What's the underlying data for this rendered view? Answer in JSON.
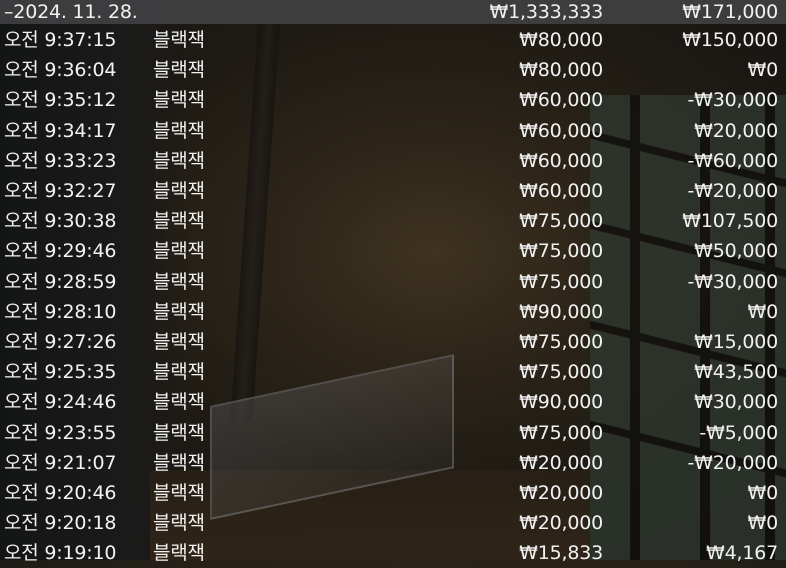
{
  "header": {
    "date": "–2024. 11. 28.",
    "total": "₩1,333,333",
    "total_diff": "₩171,000"
  },
  "rows": [
    {
      "time": "오전 9:37:15",
      "item": "블랙잭",
      "amount": "₩80,000",
      "diff": "₩150,000"
    },
    {
      "time": "오전 9:36:04",
      "item": "블랙잭",
      "amount": "₩80,000",
      "diff": "₩0"
    },
    {
      "time": "오전 9:35:12",
      "item": "블랙잭",
      "amount": "₩60,000",
      "diff": "-₩30,000"
    },
    {
      "time": "오전 9:34:17",
      "item": "블랙잭",
      "amount": "₩60,000",
      "diff": "₩20,000"
    },
    {
      "time": "오전 9:33:23",
      "item": "블랙잭",
      "amount": "₩60,000",
      "diff": "-₩60,000"
    },
    {
      "time": "오전 9:32:27",
      "item": "블랙잭",
      "amount": "₩60,000",
      "diff": "-₩20,000"
    },
    {
      "time": "오전 9:30:38",
      "item": "블랙잭",
      "amount": "₩75,000",
      "diff": "₩107,500"
    },
    {
      "time": "오전 9:29:46",
      "item": "블랙잭",
      "amount": "₩75,000",
      "diff": "₩50,000"
    },
    {
      "time": "오전 9:28:59",
      "item": "블랙잭",
      "amount": "₩75,000",
      "diff": "-₩30,000"
    },
    {
      "time": "오전 9:28:10",
      "item": "블랙잭",
      "amount": "₩90,000",
      "diff": "₩0"
    },
    {
      "time": "오전 9:27:26",
      "item": "블랙잭",
      "amount": "₩75,000",
      "diff": "₩15,000"
    },
    {
      "time": "오전 9:25:35",
      "item": "블랙잭",
      "amount": "₩75,000",
      "diff": "₩43,500"
    },
    {
      "time": "오전 9:24:46",
      "item": "블랙잭",
      "amount": "₩90,000",
      "diff": "₩30,000"
    },
    {
      "time": "오전 9:23:55",
      "item": "블랙잭",
      "amount": "₩75,000",
      "diff": "-₩5,000"
    },
    {
      "time": "오전 9:21:07",
      "item": "블랙잭",
      "amount": "₩20,000",
      "diff": "-₩20,000"
    },
    {
      "time": "오전 9:20:46",
      "item": "블랙잭",
      "amount": "₩20,000",
      "diff": "₩0"
    },
    {
      "time": "오전 9:20:18",
      "item": "블랙잭",
      "amount": "₩20,000",
      "diff": "₩0"
    },
    {
      "time": "오전 9:19:10",
      "item": "블랙잭",
      "amount": "₩15,833",
      "diff": "₩4,167"
    }
  ]
}
